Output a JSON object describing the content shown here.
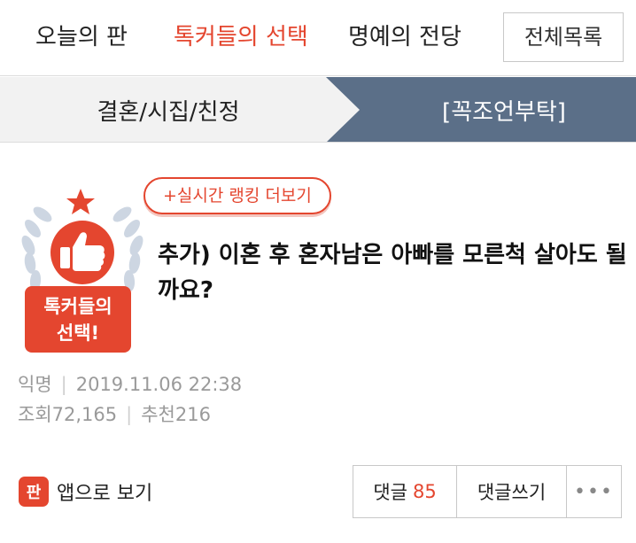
{
  "nav": {
    "tabs": [
      {
        "label": "오늘의 판"
      },
      {
        "label": "톡커들의 선택"
      },
      {
        "label": "명예의 전당"
      }
    ],
    "all_list_label": "전체목록"
  },
  "category": {
    "section": "결혼/시집/친정",
    "subsection": "[꼭조언부탁]"
  },
  "ranking_link": "+실시간 랭킹 더보기",
  "emblem": {
    "line1": "톡커들의",
    "line2": "선택!",
    "icon": "thumbs-up-icon"
  },
  "post": {
    "title": "추가) 이혼 후 혼자남은 아빠를 모른척 살아도 될까요?",
    "author": "익명",
    "date": "2019.11.06 22:38",
    "views": "조회72,165",
    "recommends": "추천216"
  },
  "bottom": {
    "app_icon_glyph": "판",
    "app_view_label": "앱으로 보기",
    "comment_label": "댓글",
    "comment_count": "85",
    "write_comment_label": "댓글쓰기",
    "more_label": "•••"
  },
  "colors": {
    "accent": "#e4462f",
    "category_active_bg": "#5b6f88",
    "category_bg": "#f2f2f2"
  }
}
